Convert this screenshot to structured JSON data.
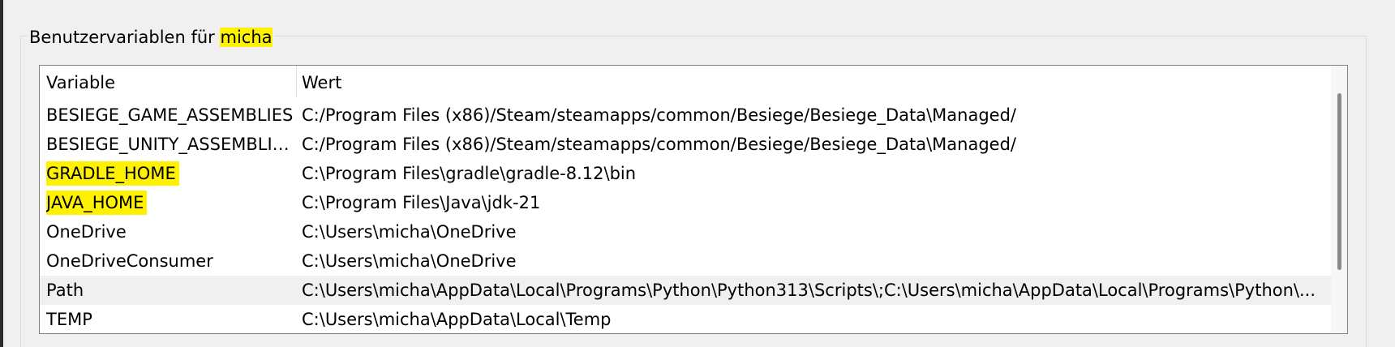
{
  "group": {
    "title_prefix": "Benutzervariablen für ",
    "title_user": "micha"
  },
  "table": {
    "columns": [
      "Variable",
      "Wert"
    ],
    "rows": [
      {
        "name": "BESIEGE_GAME_ASSEMBLIES",
        "value": "C:/Program Files (x86)/Steam/steamapps/common/Besiege/Besiege_Data\\Managed/"
      },
      {
        "name": "BESIEGE_UNITY_ASSEMBLIES",
        "value": "C:/Program Files (x86)/Steam/steamapps/common/Besiege/Besiege_Data\\Managed/"
      },
      {
        "name": "GRADLE_HOME",
        "value": "C:\\Program Files\\gradle\\gradle-8.12\\bin"
      },
      {
        "name": "JAVA_HOME",
        "value": "C:\\Program Files\\Java\\jdk-21"
      },
      {
        "name": "OneDrive",
        "value": "C:\\Users\\micha\\OneDrive"
      },
      {
        "name": "OneDriveConsumer",
        "value": "C:\\Users\\micha\\OneDrive"
      },
      {
        "name": "Path",
        "value": "C:\\Users\\micha\\AppData\\Local\\Programs\\Python\\Python313\\Scripts\\;C:\\Users\\micha\\AppData\\Local\\Programs\\Python\\..."
      },
      {
        "name": "TEMP",
        "value": "C:\\Users\\micha\\AppData\\Local\\Temp"
      }
    ]
  },
  "colors": {
    "highlight": "#fff200",
    "selected_row": "#f0f0f0"
  }
}
